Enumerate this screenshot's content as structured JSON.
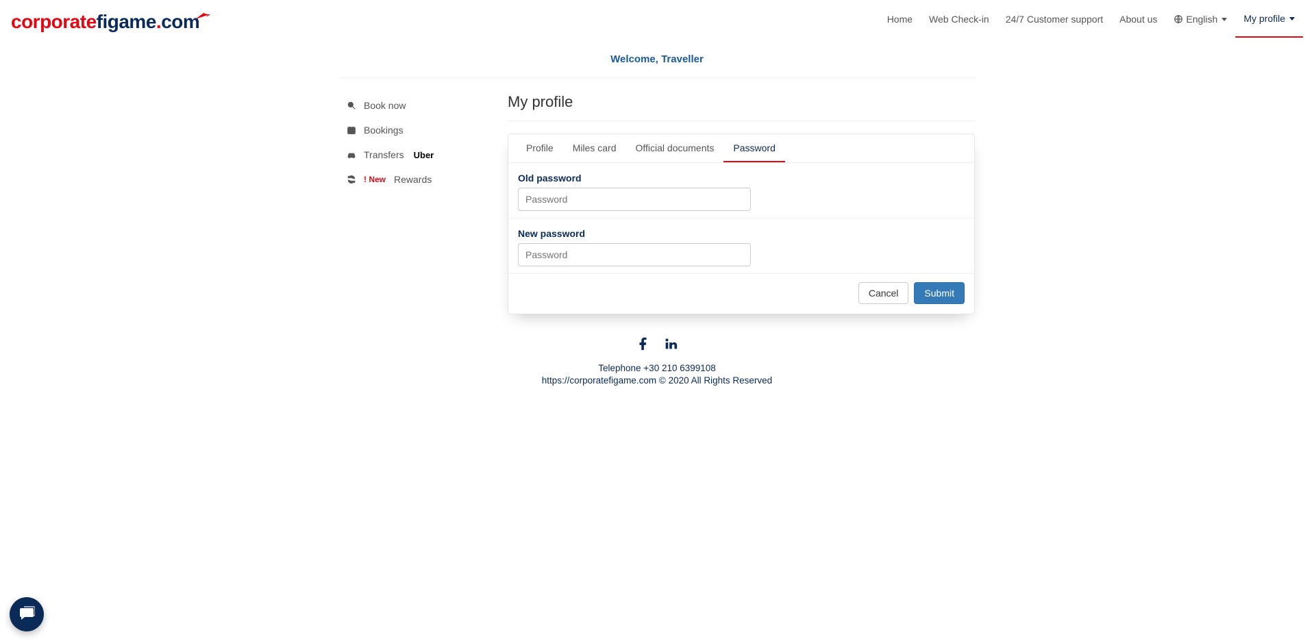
{
  "brand": {
    "part1": "corporate",
    "part2": "figame",
    "dot": ".",
    "part3": "com"
  },
  "nav": {
    "home": "Home",
    "checkin": "Web Check-in",
    "support": "24/7 Customer support",
    "about": "About us",
    "language": "English",
    "profile": "My profile"
  },
  "welcome": "Welcome, Traveller",
  "sidebar": {
    "book": "Book now",
    "bookings": "Bookings",
    "transfers": "Transfers",
    "transfers_brand": "Uber",
    "rewards_new": "! New",
    "rewards": "Rewards"
  },
  "page": {
    "title": "My profile"
  },
  "tabs": {
    "profile": "Profile",
    "miles": "Miles card",
    "docs": "Official documents",
    "password": "Password"
  },
  "form": {
    "old_label": "Old password",
    "old_placeholder": "Password",
    "old_value": "",
    "new_label": "New password",
    "new_placeholder": "Password",
    "new_value": ""
  },
  "actions": {
    "cancel": "Cancel",
    "submit": "Submit"
  },
  "footer": {
    "telephone_label": "Telephone",
    "telephone": "+30 210 6399108",
    "site": "https://corporatefigame.com",
    "rights": "© 2020 All Rights Reserved"
  }
}
